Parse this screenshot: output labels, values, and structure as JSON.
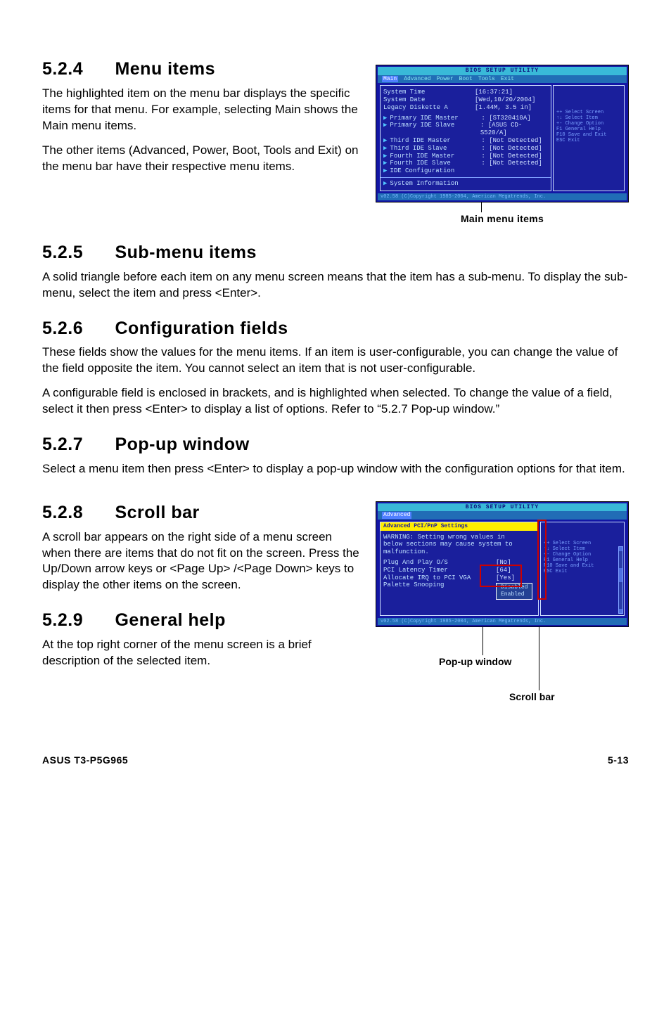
{
  "s524": {
    "heading_num": "5.2.4",
    "heading_text": "Menu items",
    "p1": "The highlighted item on the menu bar  displays the specific items for that menu. For example, selecting Main shows the Main menu items.",
    "p2": "The other items (Advanced, Power, Boot, Tools and Exit) on the menu bar have their respective menu items."
  },
  "s525": {
    "heading_num": "5.2.5",
    "heading_text": "Sub-menu items",
    "p1": "A solid triangle before each item on any menu screen means that the item has a sub-menu. To display the sub-menu, select the item and press <Enter>."
  },
  "s526": {
    "heading_num": "5.2.6",
    "heading_text": "Configuration fields",
    "p1": "These fields show the values for the menu items. If an item is user-configurable, you can change the value of the field opposite the item. You cannot select an item that is not user-configurable.",
    "p2": "A configurable field is enclosed in brackets, and is highlighted when selected. To change the value of a field, select it then press <Enter> to display a list of options. Refer to “5.2.7 Pop-up window.”"
  },
  "s527": {
    "heading_num": "5.2.7",
    "heading_text": "Pop-up window",
    "p1": "Select a menu item then press <Enter> to display a pop-up window with the configuration options for that item."
  },
  "s528": {
    "heading_num": "5.2.8",
    "heading_text": "Scroll bar",
    "p1": "A scroll bar appears on the right side of a menu screen when there are items that do not fit on the screen. Press the Up/Down arrow keys or <Page Up> /<Page Down> keys to display the other items on the screen."
  },
  "s529": {
    "heading_num": "5.2.9",
    "heading_text": "General help",
    "p1": "At the top right corner of the menu screen is a brief description of the selected item."
  },
  "bios1": {
    "topbar": "BIOS SETUP UTILITY",
    "tabs": [
      "Main",
      "Advanced",
      "Power",
      "Boot",
      "Tools",
      "Exit"
    ],
    "lines": [
      {
        "k": "System Time",
        "v": "[16:37:21]"
      },
      {
        "k": "System Date",
        "v": "[Wed,10/20/2004]"
      },
      {
        "k": "Legacy Diskette A",
        "v": "[1.44M, 3.5 in]"
      },
      {
        "k": "",
        "v": ""
      },
      {
        "arrow": true,
        "k": "Primary IDE Master",
        "v": ": [ST320410A]"
      },
      {
        "arrow": true,
        "k": "Primary IDE Slave",
        "v": ": [ASUS CD-S520/A]"
      },
      {
        "arrow": true,
        "k": "Third IDE Master",
        "v": ": [Not Detected]"
      },
      {
        "arrow": true,
        "k": "Third IDE Slave",
        "v": ": [Not Detected]"
      },
      {
        "arrow": true,
        "k": "Fourth IDE Master",
        "v": ": [Not Detected]"
      },
      {
        "arrow": true,
        "k": "Fourth IDE Slave",
        "v": ": [Not Detected]"
      },
      {
        "arrow": true,
        "k": "IDE Configuration",
        "v": ""
      },
      {
        "k": "",
        "v": ""
      },
      {
        "arrow": true,
        "k": "System Information",
        "v": ""
      }
    ],
    "right_help": [
      "++  Select Screen",
      "↑↓  Select Item",
      "+-  Change Option",
      "F1  General Help",
      "F10 Save and Exit",
      "ESC Exit"
    ],
    "bottom": "v02.58 (C)Copyright 1985-2004, American Megatrends, Inc.",
    "caption": "Main menu items"
  },
  "bios2": {
    "topbar": "BIOS SETUP UTILITY",
    "tab_sel": "Advanced",
    "panel_title": "Advanced PCI/PnP Settings",
    "warning_l1": "WARNING: Setting wrong values in",
    "warning_l2": "below sections may cause system to",
    "warning_l3": "malfunction.",
    "rows": [
      {
        "k": "Plug And Play O/S",
        "v": "[No]"
      },
      {
        "k": "PCI Latency Timer",
        "v": "[64]"
      },
      {
        "k": "Allocate IRQ to PCI VGA",
        "v": "[Yes]"
      },
      {
        "k": "Palette Snooping",
        "v": ""
      }
    ],
    "popup_opts": [
      "Disabled",
      "Enabled"
    ],
    "right_help": [
      "++  Select Screen",
      "↑↓  Select Item",
      "+-  Change Option",
      "F1  General Help",
      "F10 Save and Exit",
      "ESC Exit"
    ],
    "bottom": "v02.58 (C)Copyright 1985-2004, American Megatrends, Inc.",
    "caption_popup": "Pop-up window",
    "caption_scroll": "Scroll bar"
  },
  "footer": {
    "left": "ASUS T3-P5G965",
    "right": "5-13"
  }
}
